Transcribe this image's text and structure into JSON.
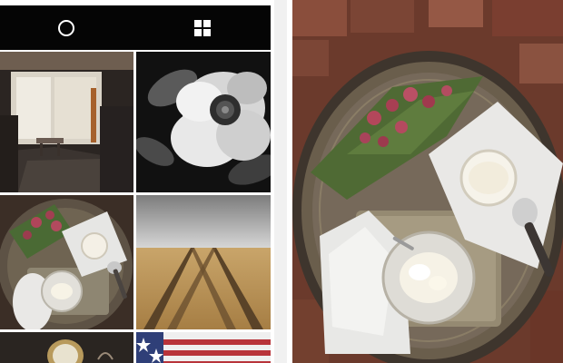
{
  "screenshot": {
    "description_colors": {
      "topbar_bg": "#050505",
      "background": "#ffffff"
    }
  },
  "topbar": {
    "tabs": [
      {
        "icon": "circle-camera-icon"
      },
      {
        "icon": "grid-icon"
      }
    ]
  },
  "grid": {
    "tiles": [
      {
        "id": "room"
      },
      {
        "id": "flower"
      },
      {
        "id": "tray"
      },
      {
        "id": "field"
      },
      {
        "id": "mirror"
      },
      {
        "id": "flag"
      }
    ]
  },
  "detail_photo": {
    "id": "tray-large"
  }
}
